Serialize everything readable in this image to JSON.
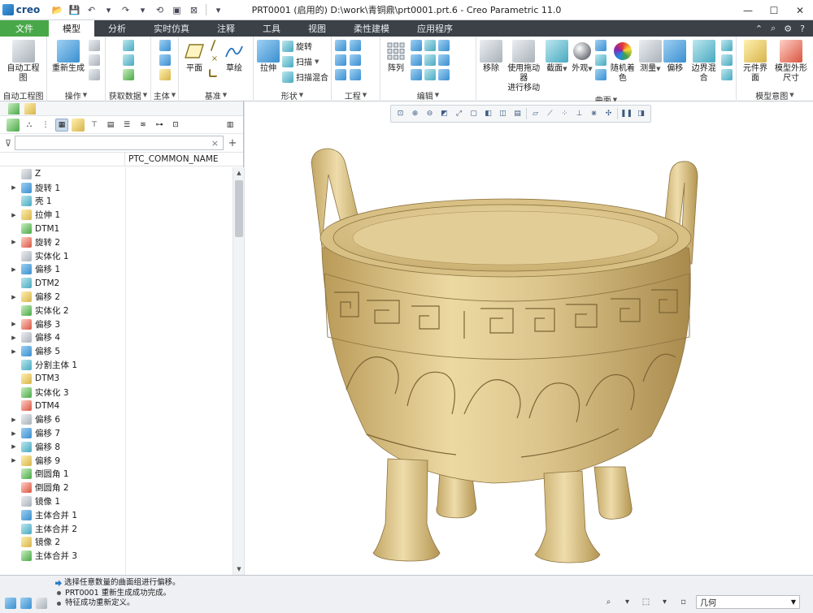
{
  "titlebar": {
    "logo_text": "creo",
    "window_title": "PRT0001 (启用的) D:\\work\\青铜鼎\\prt0001.prt.6 - Creo Parametric 11.0",
    "minimize": "—",
    "maximize": "☐",
    "close": "✕"
  },
  "tabs": [
    {
      "label": "文件"
    },
    {
      "label": "模型"
    },
    {
      "label": "分析"
    },
    {
      "label": "实时仿真"
    },
    {
      "label": "注释"
    },
    {
      "label": "工具"
    },
    {
      "label": "视图"
    },
    {
      "label": "柔性建模"
    },
    {
      "label": "应用程序"
    }
  ],
  "ribbon": {
    "auto_drawing": {
      "btn": "自动工程图",
      "group": "自动工程图"
    },
    "operations": {
      "btn": "重新生成",
      "group": "操作"
    },
    "get_data": {
      "group": "获取数据"
    },
    "body": {
      "group": "主体"
    },
    "datum": {
      "plane": "平面",
      "sketch": "草绘",
      "group": "基准"
    },
    "shapes": {
      "extrude": "拉伸",
      "revolve": "旋转",
      "sweep": "扫描",
      "swept_blend": "扫描混合",
      "group": "形状"
    },
    "engineering": {
      "group": "工程"
    },
    "editing": {
      "pattern": "阵列",
      "group": "编辑"
    },
    "surfaces": {
      "remove": "移除",
      "drag_move_1": "使用拖动器",
      "drag_move_2": "进行移动",
      "section": "截面",
      "appearance": "外观",
      "random_color": "随机着色",
      "measure": "测量",
      "offset": "偏移",
      "boundary_blend": "边界混合",
      "group": "曲面"
    },
    "model_intent": {
      "component_interface": "元件界面",
      "envelope_1": "模型外形",
      "envelope_2": "尺寸",
      "group": "模型意图"
    }
  },
  "model_tree": {
    "column_header": "PTC_COMMON_NAME",
    "items": [
      {
        "label": "Z",
        "expandable": false
      },
      {
        "label": "旋转 1",
        "expandable": true
      },
      {
        "label": "壳 1",
        "expandable": false
      },
      {
        "label": "拉伸 1",
        "expandable": true
      },
      {
        "label": "DTM1",
        "expandable": false
      },
      {
        "label": "旋转 2",
        "expandable": true
      },
      {
        "label": "实体化 1",
        "expandable": false
      },
      {
        "label": "偏移 1",
        "expandable": true
      },
      {
        "label": "DTM2",
        "expandable": false
      },
      {
        "label": "偏移 2",
        "expandable": true
      },
      {
        "label": "实体化 2",
        "expandable": false
      },
      {
        "label": "偏移 3",
        "expandable": true
      },
      {
        "label": "偏移 4",
        "expandable": true
      },
      {
        "label": "偏移 5",
        "expandable": true
      },
      {
        "label": "分割主体 1",
        "expandable": false
      },
      {
        "label": "DTM3",
        "expandable": false
      },
      {
        "label": "实体化 3",
        "expandable": false
      },
      {
        "label": "DTM4",
        "expandable": false
      },
      {
        "label": "偏移 6",
        "expandable": true
      },
      {
        "label": "偏移 7",
        "expandable": true
      },
      {
        "label": "偏移 8",
        "expandable": true
      },
      {
        "label": "偏移 9",
        "expandable": true
      },
      {
        "label": "倒圆角 1",
        "expandable": false
      },
      {
        "label": "倒圆角 2",
        "expandable": false
      },
      {
        "label": "镜像 1",
        "expandable": false
      },
      {
        "label": "主体合并 1",
        "expandable": false
      },
      {
        "label": "主体合并 2",
        "expandable": false
      },
      {
        "label": "镜像 2",
        "expandable": false
      },
      {
        "label": "主体合并 3",
        "expandable": false
      }
    ]
  },
  "messages": [
    "选择任意数量的曲面组进行偏移。",
    "PRT0001 重新生成成功完成。",
    "特征成功重新定义。"
  ],
  "status": {
    "filter_value": "几何"
  },
  "colors": {
    "file_tab": "#48a849",
    "tab_bar": "#3b4147",
    "bronze": "#d9c38a"
  }
}
